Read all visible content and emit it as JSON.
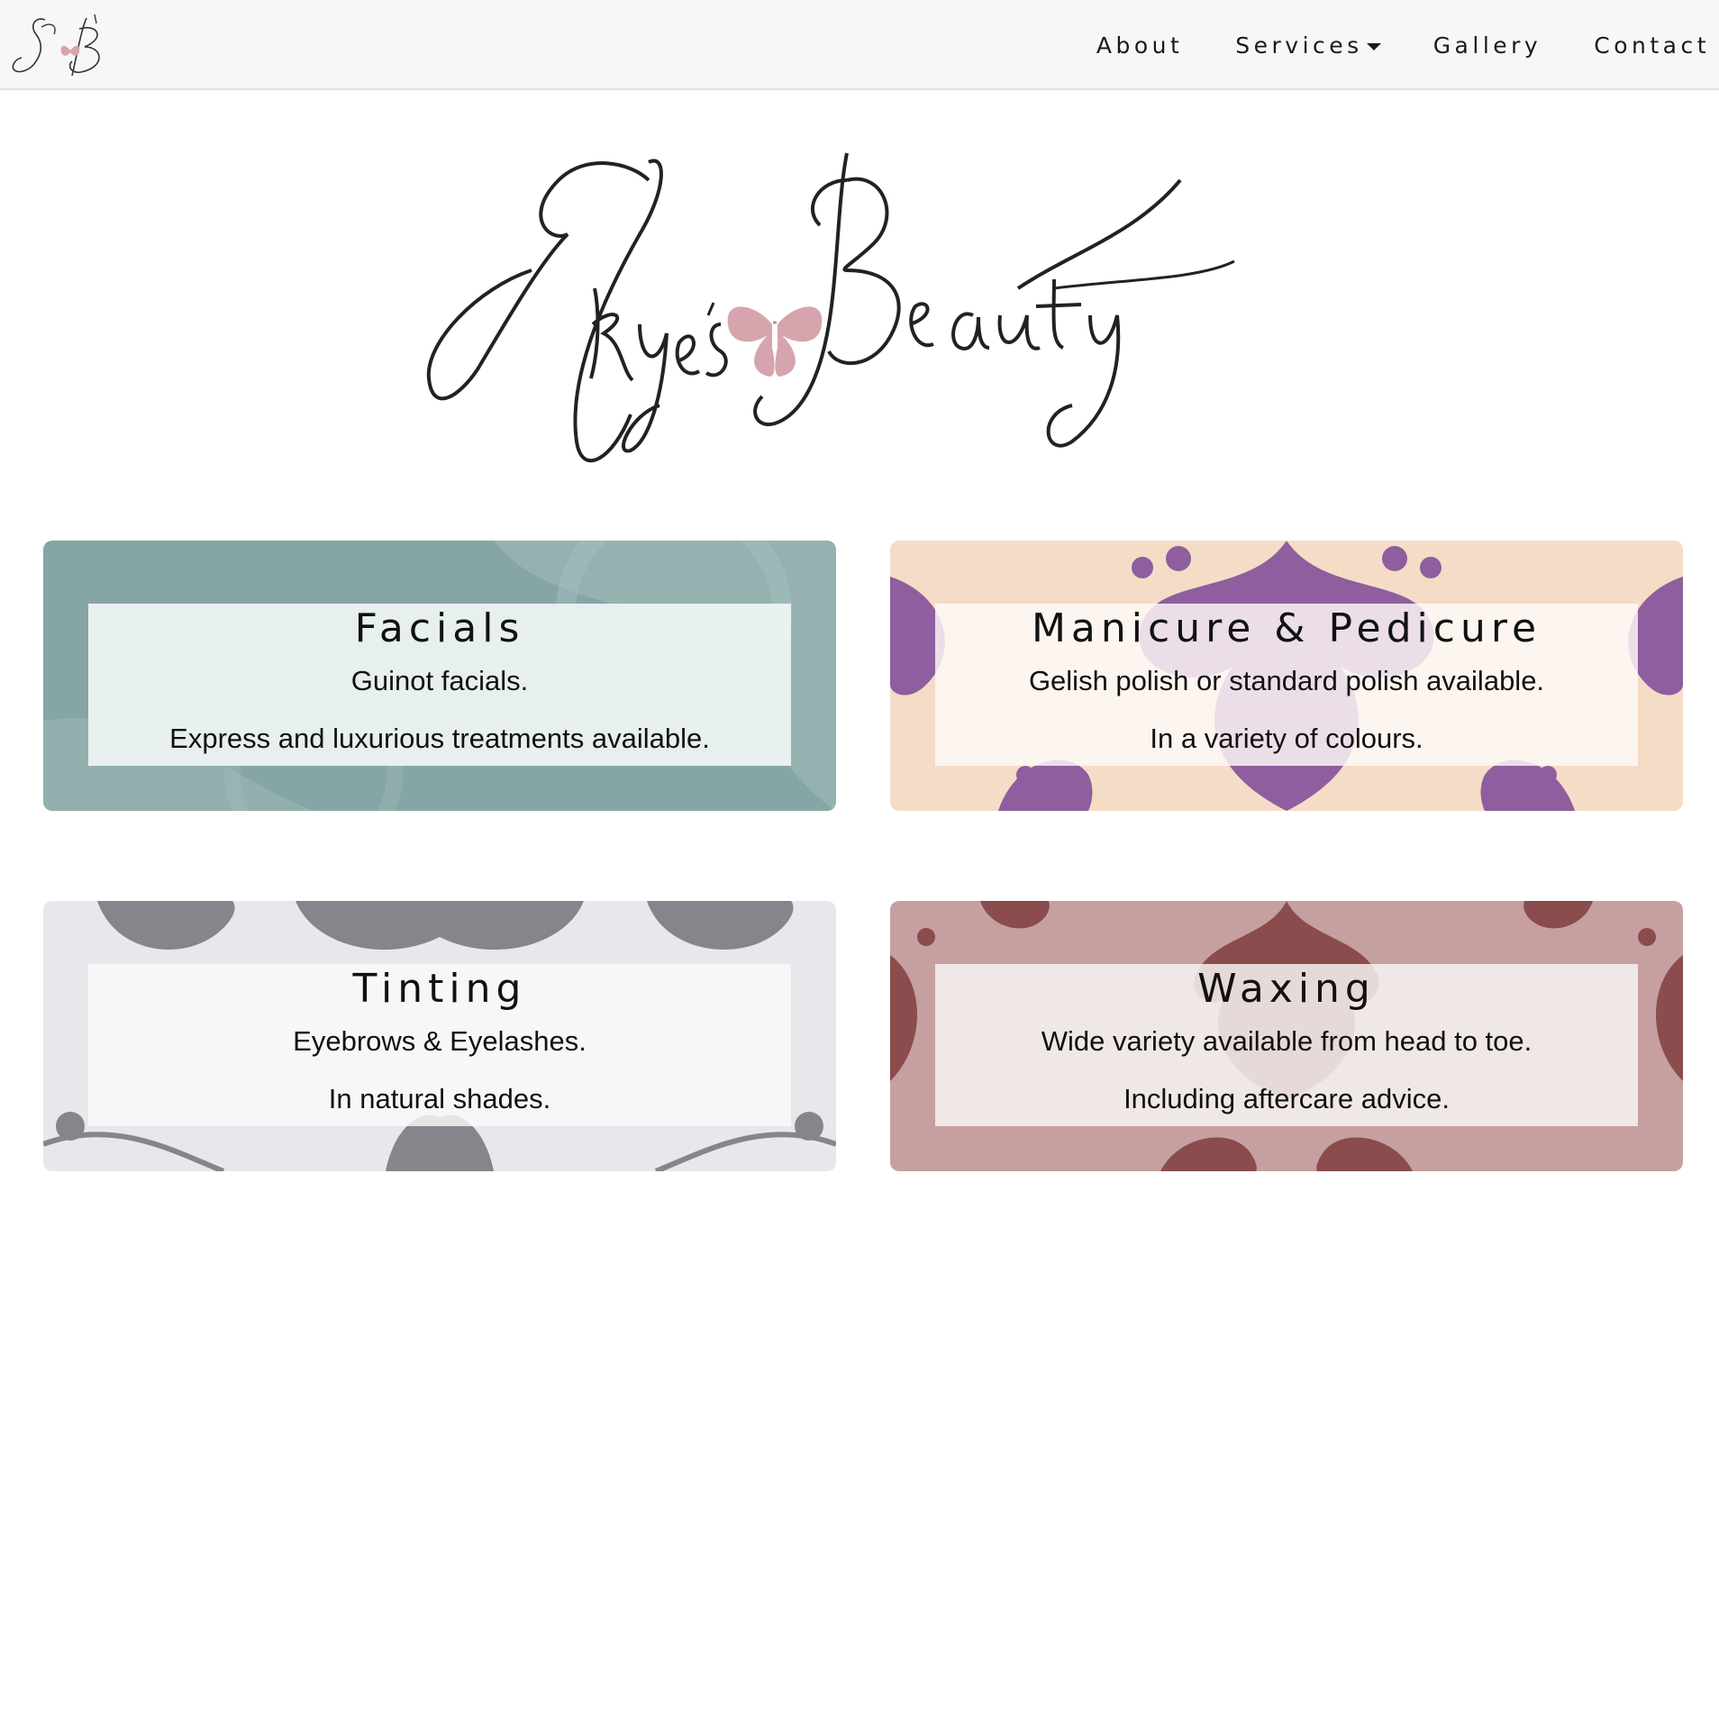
{
  "navbar": {
    "logo_icon": "sb-monogram-logo",
    "links": [
      {
        "label": "About"
      },
      {
        "label": "Services",
        "has_dropdown": true
      },
      {
        "label": "Gallery"
      },
      {
        "label": "Contact"
      }
    ]
  },
  "hero": {
    "logo_text": "Skye's Beauty",
    "logo_icon": "butterfly-icon"
  },
  "services": [
    {
      "title": "Facials",
      "line1": "Guinot facials.",
      "line2": "Express and luxurious treatments available.",
      "bg_color": "#8aa8a8",
      "pattern_color": "#a9c2c0"
    },
    {
      "title": "Manicure & Pedicure",
      "line1": "Gelish polish or standard polish available.",
      "line2": "In a variety of colours.",
      "bg_color": "#f5dcc6",
      "pattern_color": "#8e5e9e"
    },
    {
      "title": "Tinting",
      "line1": "Eyebrows & Eyelashes.",
      "line2": "In natural shades.",
      "bg_color": "#e7e7eb",
      "pattern_color": "#84848a"
    },
    {
      "title": "Waxing",
      "line1": "Wide variety available from head to toe.",
      "line2": "Including aftercare advice.",
      "bg_color": "#c6a0a0",
      "pattern_color": "#8a4c4c"
    }
  ],
  "colors": {
    "butterfly": "#d6a4ad",
    "navbar_bg": "#f7f7f7"
  }
}
